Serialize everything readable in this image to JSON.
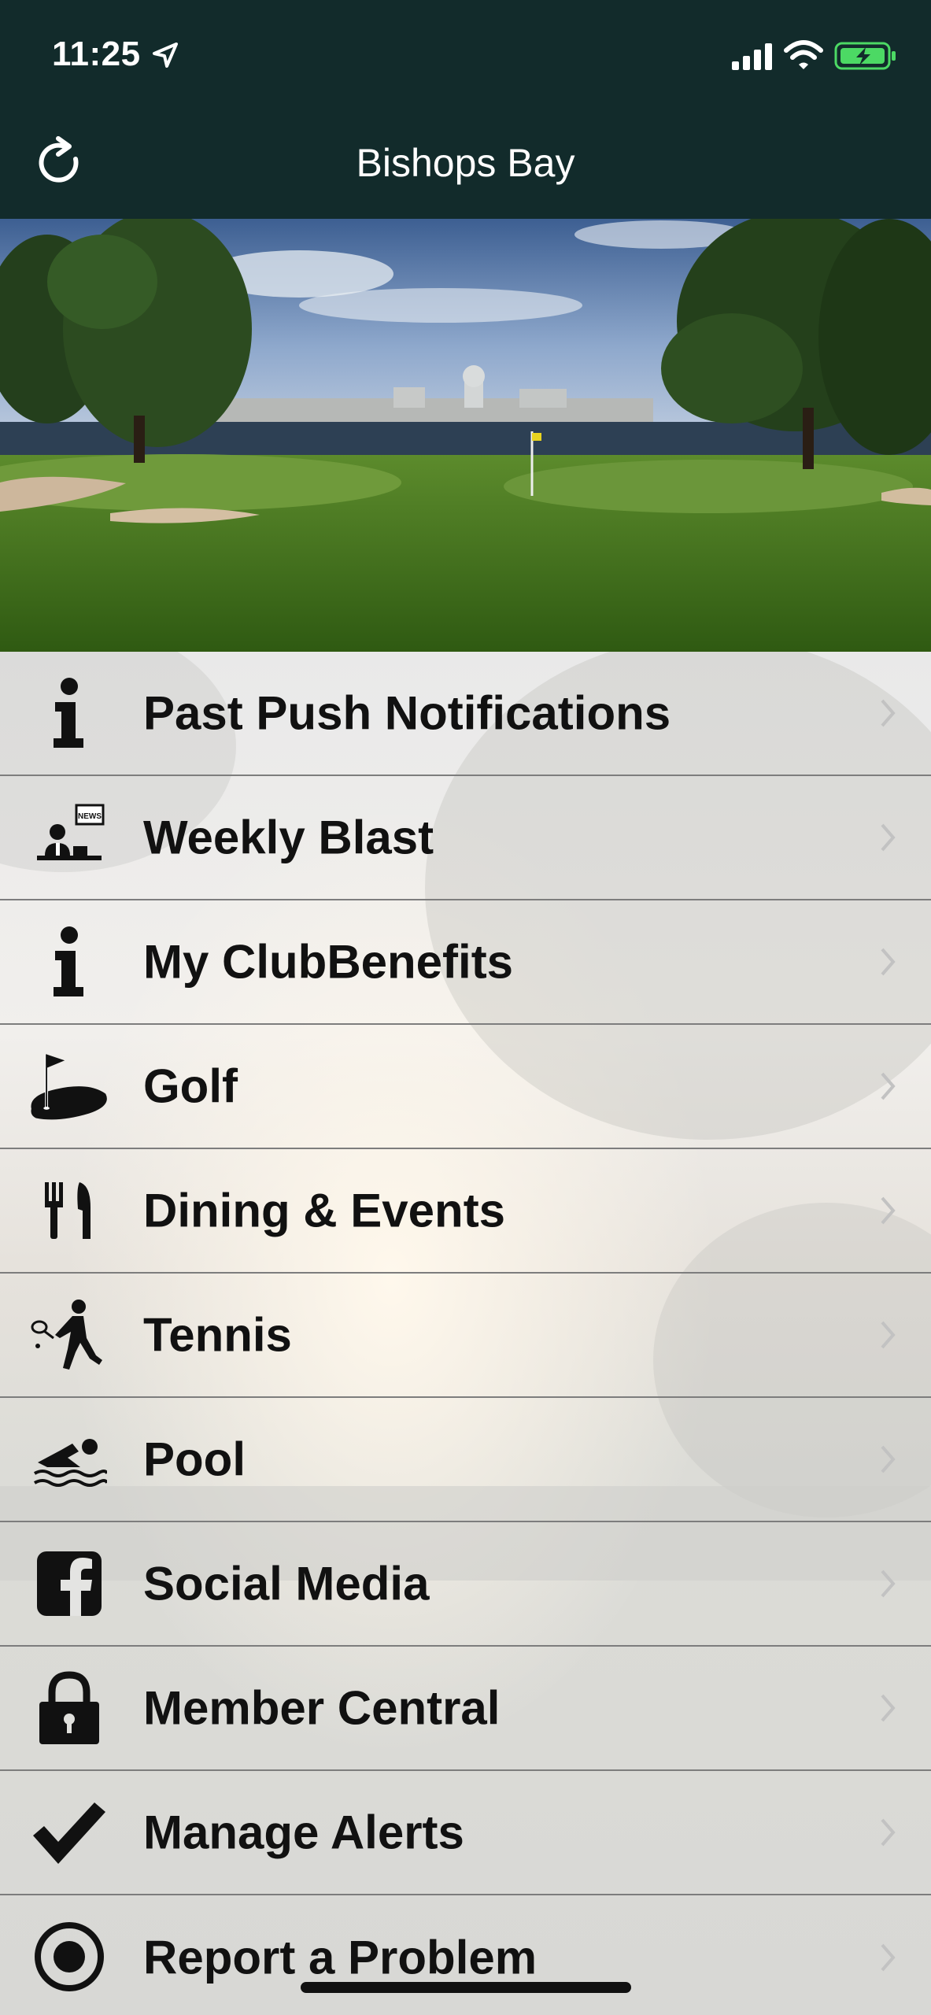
{
  "status_bar": {
    "time": "11:25"
  },
  "header": {
    "title": "Bishops Bay"
  },
  "menu": {
    "items": [
      {
        "label": "Past Push Notifications",
        "icon": "info-icon"
      },
      {
        "label": "Weekly Blast",
        "icon": "news-presenter-icon"
      },
      {
        "label": "My ClubBenefits",
        "icon": "info-icon"
      },
      {
        "label": "Golf",
        "icon": "golf-flag-icon"
      },
      {
        "label": "Dining & Events",
        "icon": "fork-knife-icon"
      },
      {
        "label": "Tennis",
        "icon": "tennis-player-icon"
      },
      {
        "label": "Pool",
        "icon": "swimmer-icon"
      },
      {
        "label": "Social Media",
        "icon": "facebook-icon"
      },
      {
        "label": "Member Central",
        "icon": "lock-icon"
      },
      {
        "label": "Manage Alerts",
        "icon": "checkmark-icon"
      },
      {
        "label": "Report a Problem",
        "icon": "record-icon"
      }
    ]
  },
  "colors": {
    "header_bg": "#122b2b",
    "battery_fill": "#4cd964"
  }
}
